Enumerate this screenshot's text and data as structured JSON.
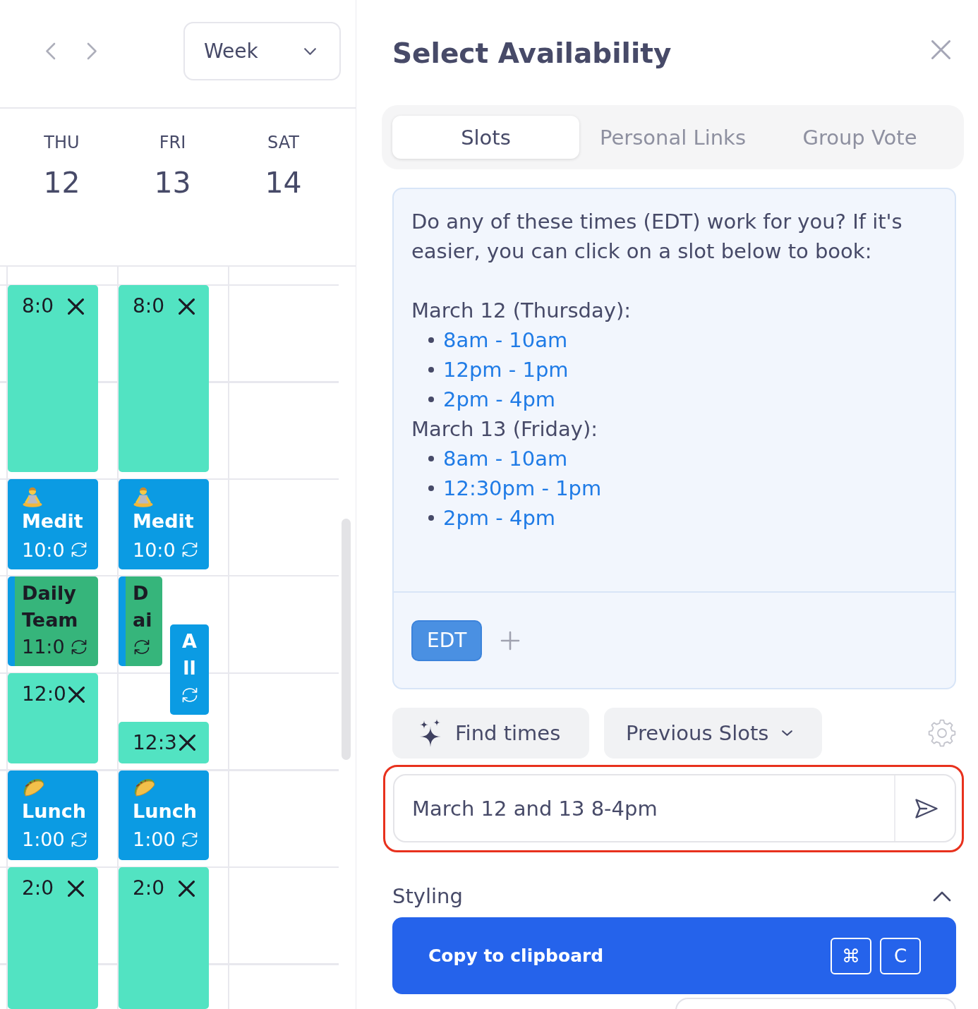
{
  "calendar": {
    "view_select": {
      "value": "Week"
    },
    "days": [
      {
        "weekday": "THU",
        "date": "12",
        "events": [
          {
            "kind": "slot",
            "time": "8:0",
            "color": "#52e3c2"
          },
          {
            "kind": "meditation",
            "title": "Medit",
            "time": "10:0",
            "recurring": true,
            "color": "#0b9be3"
          },
          {
            "kind": "meeting",
            "title": "Daily Team",
            "time": "11:0",
            "recurring": true,
            "color": "#36b57b"
          },
          {
            "kind": "slot",
            "time": "12:0",
            "color": "#52e3c2"
          },
          {
            "kind": "lunch",
            "title": "Lunch",
            "time": "1:00",
            "recurring": true,
            "color": "#0b9be3"
          },
          {
            "kind": "slot",
            "time": "2:0",
            "color": "#52e3c2"
          }
        ]
      },
      {
        "weekday": "FRI",
        "date": "13",
        "events": [
          {
            "kind": "slot",
            "time": "8:0",
            "color": "#52e3c2"
          },
          {
            "kind": "meditation",
            "title": "Medit",
            "time": "10:0",
            "recurring": true,
            "color": "#0b9be3"
          },
          {
            "kind": "meeting",
            "title": "Dai",
            "recurring": true,
            "color": "#36b57b"
          },
          {
            "kind": "event",
            "title": "All",
            "recurring": true,
            "color": "#0b9be3"
          },
          {
            "kind": "slot",
            "time": "12:3",
            "color": "#52e3c2"
          },
          {
            "kind": "lunch",
            "title": "Lunch",
            "time": "1:00",
            "recurring": true,
            "color": "#0b9be3"
          },
          {
            "kind": "slot",
            "time": "2:0",
            "color": "#52e3c2"
          }
        ]
      },
      {
        "weekday": "SAT",
        "date": "14"
      }
    ]
  },
  "panel": {
    "title": "Select Availability",
    "tabs": [
      {
        "label": "Slots",
        "selected": true
      },
      {
        "label": "Personal Links",
        "selected": false
      },
      {
        "label": "Group Vote",
        "selected": false
      }
    ],
    "message": {
      "intro": "Do any of these times (EDT) work for you? If it's easier, you can click on a slot below to book:",
      "days": [
        {
          "heading": "March 12 (Thursday):",
          "slots": [
            "8am - 10am",
            "12pm - 1pm",
            "2pm - 4pm"
          ]
        },
        {
          "heading": "March 13 (Friday):",
          "slots": [
            "8am - 10am",
            "12:30pm - 1pm",
            "2pm - 4pm"
          ]
        }
      ]
    },
    "timezones": [
      {
        "label": "EDT"
      }
    ],
    "find_button": {
      "label": "Find times"
    },
    "previous_slots": {
      "label": "Previous Slots"
    },
    "prompt": {
      "value": "March 12 and 13 8-4pm",
      "highlighted": true
    },
    "styling": {
      "label": "Styling",
      "expanded": true
    },
    "copy_button": {
      "label": "Copy to clipboard",
      "shortcut": [
        "⌘",
        "C"
      ]
    }
  }
}
